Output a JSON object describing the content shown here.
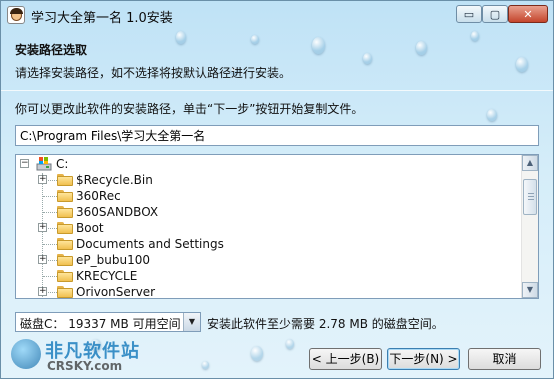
{
  "window": {
    "title": "学习大全第一名 1.0安装",
    "controls": {
      "minimize": "▭",
      "maximize": "▢",
      "close": "✕"
    }
  },
  "header": {
    "title": "安装路径选取",
    "subtitle": "请选择安装路径，如不选择将按默认路径进行安装。"
  },
  "instruction": "你可以更改此软件的安装路径，单击“下一步”按钮开始复制文件。",
  "install_path": {
    "value": "C:\\Program Files\\学习大全第一名"
  },
  "tree": {
    "root": "C:",
    "items": [
      {
        "label": "$Recycle.Bin",
        "expandable": true
      },
      {
        "label": "360Rec",
        "expandable": false
      },
      {
        "label": "360SANDBOX",
        "expandable": false
      },
      {
        "label": "Boot",
        "expandable": true
      },
      {
        "label": "Documents and Settings",
        "expandable": false
      },
      {
        "label": "eP_bubu100",
        "expandable": true
      },
      {
        "label": "KRECYCLE",
        "expandable": false
      },
      {
        "label": "OrivonServer",
        "expandable": true
      }
    ]
  },
  "disk": {
    "selected": "磁盘C： 19337 MB 可用空间",
    "requirement": "安装此软件至少需要 2.78 MB 的磁盘空间。"
  },
  "watermark": {
    "cn": "非凡软件站",
    "en": "CRSKY.com"
  },
  "buttons": {
    "back": "< 上一步(B)",
    "next": "下一步(N) >",
    "cancel": "取消"
  },
  "colors": {
    "accent": "#3c7fb1",
    "background_top": "#bfe2f6"
  }
}
